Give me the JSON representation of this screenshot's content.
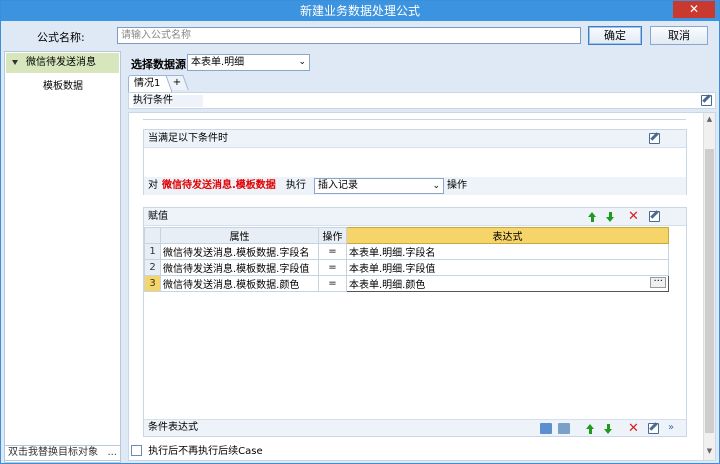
{
  "window": {
    "title": "新建业务数据处理公式",
    "close_label": "✕"
  },
  "formula": {
    "name_label": "公式名称:",
    "name_placeholder": "请输入公式名称",
    "ok_label": "确定",
    "cancel_label": "取消"
  },
  "sidebar": {
    "items": [
      {
        "label": "微信待发送消息",
        "selected": true
      },
      {
        "label": "模板数据",
        "selected": false
      }
    ],
    "replace_label": "双击我替换目标对象",
    "replace_dots": "..."
  },
  "source": {
    "label": "选择数据源",
    "value": "本表单.明细"
  },
  "tabs": [
    {
      "label": "情况1"
    },
    {
      "label": "+"
    }
  ],
  "condition": {
    "label": "执行条件"
  },
  "when_panel": {
    "title": "当满足以下条件时",
    "do_prefix": "对",
    "target": "微信待发送消息.模板数据",
    "exec_label": "执行",
    "action_value": "插入记录",
    "op_label": "操作"
  },
  "assign_panel": {
    "title": "赋值",
    "columns": [
      "属性",
      "操作",
      "表达式"
    ],
    "rows": [
      {
        "num": "1",
        "attr": "微信待发送消息.模板数据.字段名",
        "op": "=",
        "expr": "本表单.明细.字段名"
      },
      {
        "num": "2",
        "attr": "微信待发送消息.模板数据.字段值",
        "op": "=",
        "expr": "本表单.明细.字段值"
      },
      {
        "num": "3",
        "attr": "微信待发送消息.模板数据.颜色",
        "op": "=",
        "expr": "本表单.明细.颜色"
      }
    ],
    "selected_row": 3,
    "ellipsis": "···",
    "footer_label": "条件表达式"
  },
  "checkbox": {
    "label": "执行后不再执行后续Case",
    "checked": false
  },
  "colors": {
    "titlebar": "#3c93e0",
    "highlight": "#f5d56a",
    "target_text": "#e00000",
    "arrow": "#1e9a1e",
    "delete": "#d42020"
  }
}
